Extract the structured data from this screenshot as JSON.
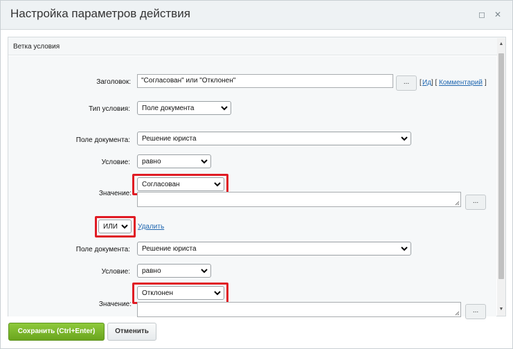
{
  "dialog": {
    "title": "Настройка параметров действия",
    "minimize_symbol": "◻",
    "close_symbol": "✕"
  },
  "section": {
    "title": "Ветка условия"
  },
  "form": {
    "title_label": "Заголовок:",
    "title_value": "\"Согласован\" или \"Отклонен\"",
    "dots_label": "...",
    "links_open": "[",
    "id_link": "Ид",
    "links_mid": "] [",
    "comment_link": "Комментарий",
    "links_close": "]",
    "condition_type_label": "Тип условия:",
    "condition_type_value": "Поле документа"
  },
  "conditions": [
    {
      "field_label": "Поле документа:",
      "field_value": "Решение юриста",
      "condition_label": "Условие:",
      "condition_value": "равно",
      "value_label": "Значение:",
      "value_value": "Согласован"
    },
    {
      "field_label": "Поле документа:",
      "field_value": "Решение юриста",
      "condition_label": "Условие:",
      "condition_value": "равно",
      "value_label": "Значение:",
      "value_value": "Отклонен"
    }
  ],
  "joiner": {
    "operator": "ИЛИ",
    "delete_label": "Удалить"
  },
  "footer": {
    "save_label": "Сохранить (Ctrl+Enter)",
    "cancel_label": "Отменить"
  },
  "colors": {
    "highlight": "#e01b24",
    "save_button": "#6aa51e",
    "link": "#2067b0"
  }
}
